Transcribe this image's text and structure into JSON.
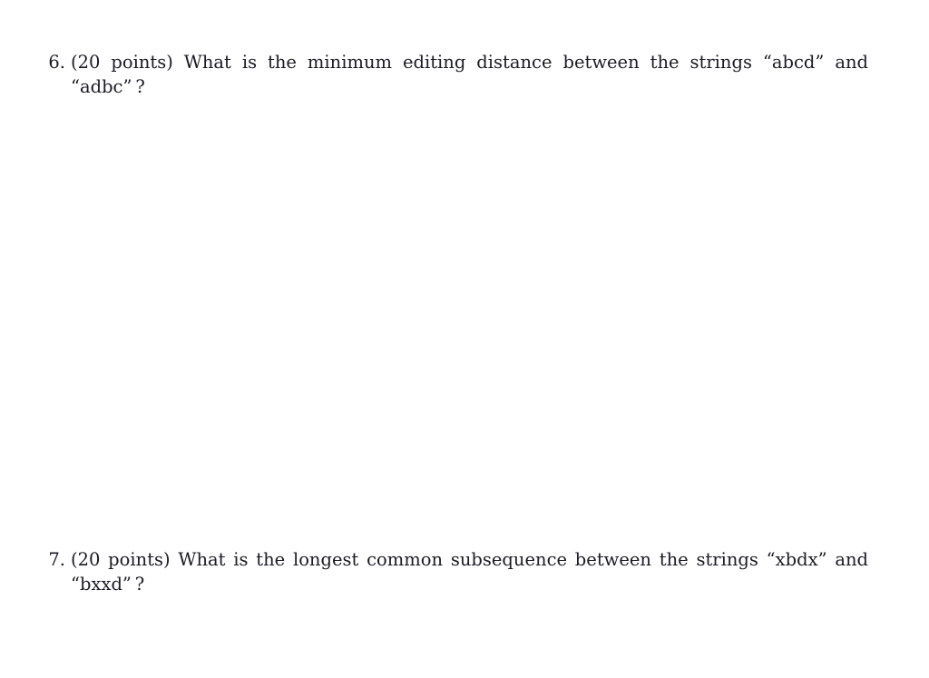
{
  "document": {
    "background_color": "#ffffff",
    "text_color": "#1b1b24"
  },
  "questions": [
    {
      "number": "6.",
      "points_label": "(20 points)",
      "text": "(20 points) What is the minimum editing distance between the strings “abcd” and “adbc” ?",
      "prompt": "What is the minimum editing distance between the strings",
      "string_a": "“abcd”",
      "string_b": "“adbc”",
      "conjunction": "and",
      "terminator": "?"
    },
    {
      "number": "7.",
      "points_label": "(20 points)",
      "text": "(20 points) What is the longest common subsequence between the strings “xbdx” and “bxxd” ?",
      "prompt": "What is the longest common subsequence between the strings",
      "string_a": "“xbdx”",
      "string_b": "“bxxd”",
      "conjunction": "and",
      "terminator": "?"
    }
  ]
}
